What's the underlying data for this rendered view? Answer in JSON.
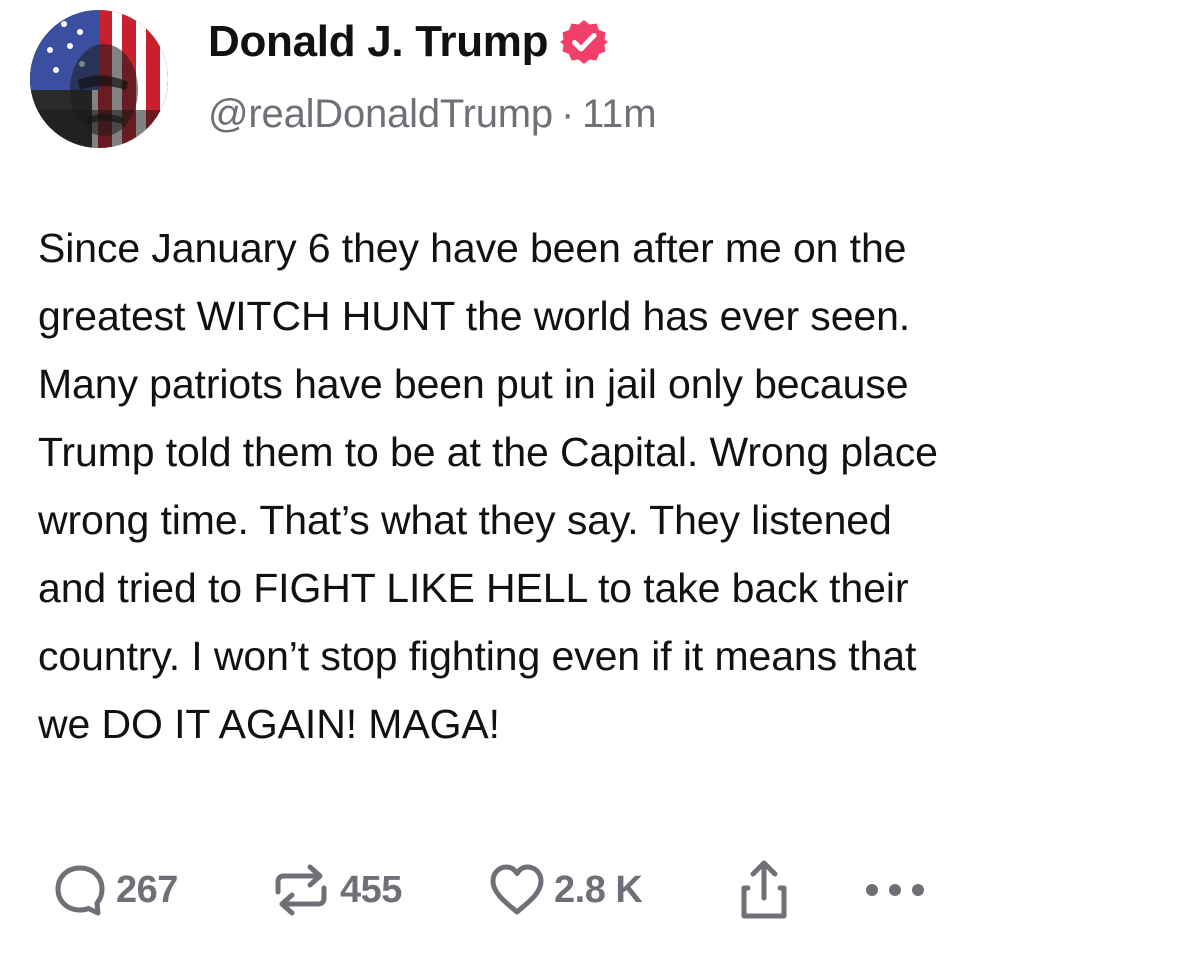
{
  "author": {
    "display_name": "Donald J. Trump",
    "handle": "@realDonaldTrump",
    "separator": "·",
    "time_ago": "11m",
    "verified_badge_icon": "verified-check-icon",
    "verified_badge_color": "#f0406a"
  },
  "post": {
    "lines": [
      "Since January 6 they have been after me on the",
      "greatest WITCH HUNT the world has ever seen.",
      "Many patriots have been put in jail only because",
      "Trump told them to be at the Capital. Wrong place",
      "wrong time. That’s what they say. They listened",
      "and tried to FIGHT LIKE HELL to take back their",
      "country. I won’t stop fighting even if it means that",
      "we DO IT AGAIN! MAGA!"
    ]
  },
  "actions": {
    "reply": {
      "icon": "reply-bubble-icon",
      "count": "267"
    },
    "repost": {
      "icon": "repost-arrows-icon",
      "count": "455"
    },
    "like": {
      "icon": "heart-icon",
      "count": "2.8 K"
    },
    "share": {
      "icon": "share-upload-icon"
    },
    "more": {
      "icon": "more-dots-icon"
    }
  },
  "colors": {
    "text_primary": "#111111",
    "text_secondary": "#6f6f77",
    "badge": "#f0406a"
  }
}
